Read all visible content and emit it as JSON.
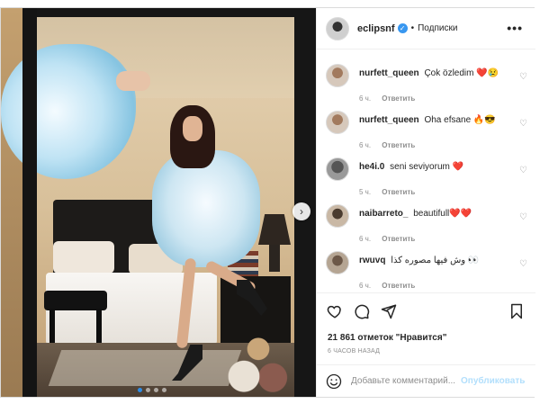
{
  "post": {
    "username": "eclipsnf",
    "separator": "•",
    "follow_label": "Подписки",
    "more_label": "•••"
  },
  "comments": [
    {
      "user": "nurfett_queen",
      "text": "Çok özledim ❤️😢",
      "time": "6 ч.",
      "reply": "Ответить"
    },
    {
      "user": "nurfett_queen",
      "text": "Oha efsane 🔥😎",
      "time": "6 ч.",
      "reply": "Ответить"
    },
    {
      "user": "he4i.0",
      "text": "seni seviyorum ❤️",
      "time": "5 ч.",
      "reply": "Ответить"
    },
    {
      "user": "naibarreto_",
      "text": "beautifull❤️❤️",
      "time": "6 ч.",
      "reply": "Ответить"
    },
    {
      "user": "rwuvq",
      "text": "وش فيها مصوره كذا 👀",
      "time": "6 ч.",
      "reply": "Ответить"
    }
  ],
  "likes_text": "21 861 отметок \"Нравится\"",
  "time_ago": "6 ЧАСОВ НАЗАД",
  "add_comment": {
    "placeholder": "Добавьте комментарий...",
    "publish_label": "Опубликовать"
  },
  "carousel": {
    "next_arrow": "›",
    "total_slides": 4,
    "active_slide": 1
  },
  "colors": {
    "accent": "#3897f0",
    "publish_disabled": "#b2dffc",
    "muted": "#8e8e8e",
    "text": "#262626"
  },
  "icons": {
    "header": [
      "verified-badge-icon",
      "more-options-icon"
    ],
    "actions": [
      "heart-icon",
      "comment-bubble-icon",
      "share-plane-icon",
      "bookmark-icon"
    ],
    "input": [
      "smile-emoji-icon"
    ]
  }
}
